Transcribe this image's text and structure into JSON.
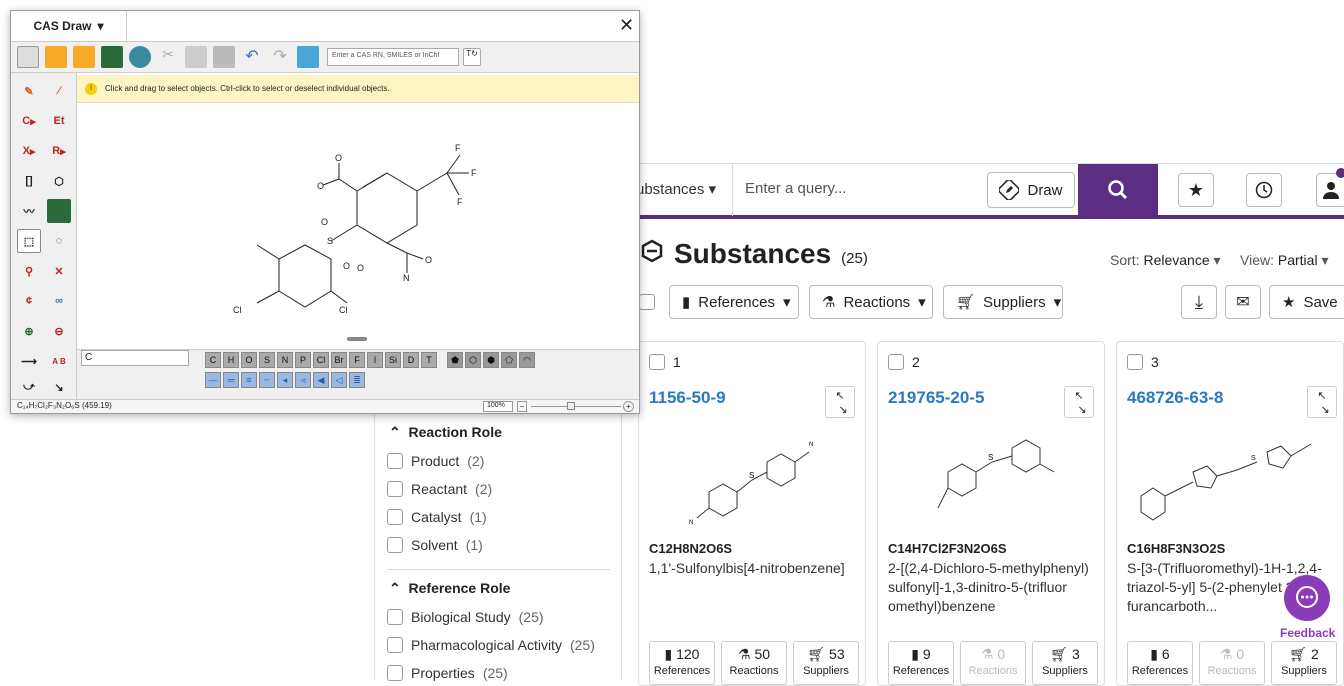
{
  "header": {
    "scope_label": "ubstances",
    "query_placeholder": "Enter a query...",
    "draw_label": "Draw"
  },
  "page": {
    "title": "Substances",
    "count": "(25)",
    "sort_label": "Sort:",
    "sort_value": "Relevance",
    "view_label": "View:",
    "view_value": "Partial"
  },
  "toolbar": {
    "references": "References",
    "reactions": "Reactions",
    "suppliers": "Suppliers",
    "save": "Save"
  },
  "results": [
    {
      "index": "1",
      "cas": "1156-50-9",
      "formula": "C12H8N2O6S",
      "name": "1,1'-Sulfonylbis[4-nitrobenzene]",
      "references": "120",
      "reactions": "50",
      "suppliers": "53"
    },
    {
      "index": "2",
      "cas": "219765-20-5",
      "formula": "C14H7Cl2F3N2O6S",
      "name": "2-[(2,4-Dichloro-5-methylphenyl) sulfonyl]-1,3-dinitro-5-(trifluor omethyl)benzene",
      "references": "9",
      "reactions": "0",
      "suppliers": "3"
    },
    {
      "index": "3",
      "cas": "468726-63-8",
      "formula": "C16H8F3N3O2S",
      "name": "S-[3-(Trifluoromethyl)-1H-1,2,4-triazol-5-yl] 5-(2-phenylet 2-furancarboth...",
      "references": "6",
      "reactions": "0",
      "suppliers": "2"
    }
  ],
  "stat_labels": {
    "references": "References",
    "reactions": "Reactions",
    "suppliers": "Suppliers"
  },
  "filters": {
    "reaction_role": {
      "title": "Reaction Role",
      "items": [
        {
          "label": "Product",
          "count": "(2)"
        },
        {
          "label": "Reactant",
          "count": "(2)"
        },
        {
          "label": "Catalyst",
          "count": "(1)"
        },
        {
          "label": "Solvent",
          "count": "(1)"
        }
      ]
    },
    "reference_role": {
      "title": "Reference Role",
      "items": [
        {
          "label": "Biological Study",
          "count": "(25)"
        },
        {
          "label": "Pharmacological Activity",
          "count": "(25)"
        },
        {
          "label": "Properties",
          "count": "(25)"
        }
      ]
    }
  },
  "feedback": "Feedback",
  "cas_draw": {
    "tab_title": "CAS Draw",
    "input_placeholder": "Enter a CAS RN, SMILES or InChI",
    "info_text": "Click and drag to select objects. Ctrl-click to select or deselect individual objects.",
    "element_input": "C",
    "elements": [
      "C",
      "H",
      "O",
      "S",
      "N",
      "P",
      "Cl",
      "Br",
      "F",
      "I",
      "Si",
      "D",
      "T"
    ],
    "left_labels": [
      "C",
      "Et",
      "X",
      "R"
    ],
    "status": "C₁₄H₇Cl₂F₃N₂O₆S (459.19)",
    "zoom": "100%"
  },
  "colors": {
    "brand": "#5b2d83",
    "link": "#2a79c5",
    "feedback": "#8a3bb7"
  }
}
